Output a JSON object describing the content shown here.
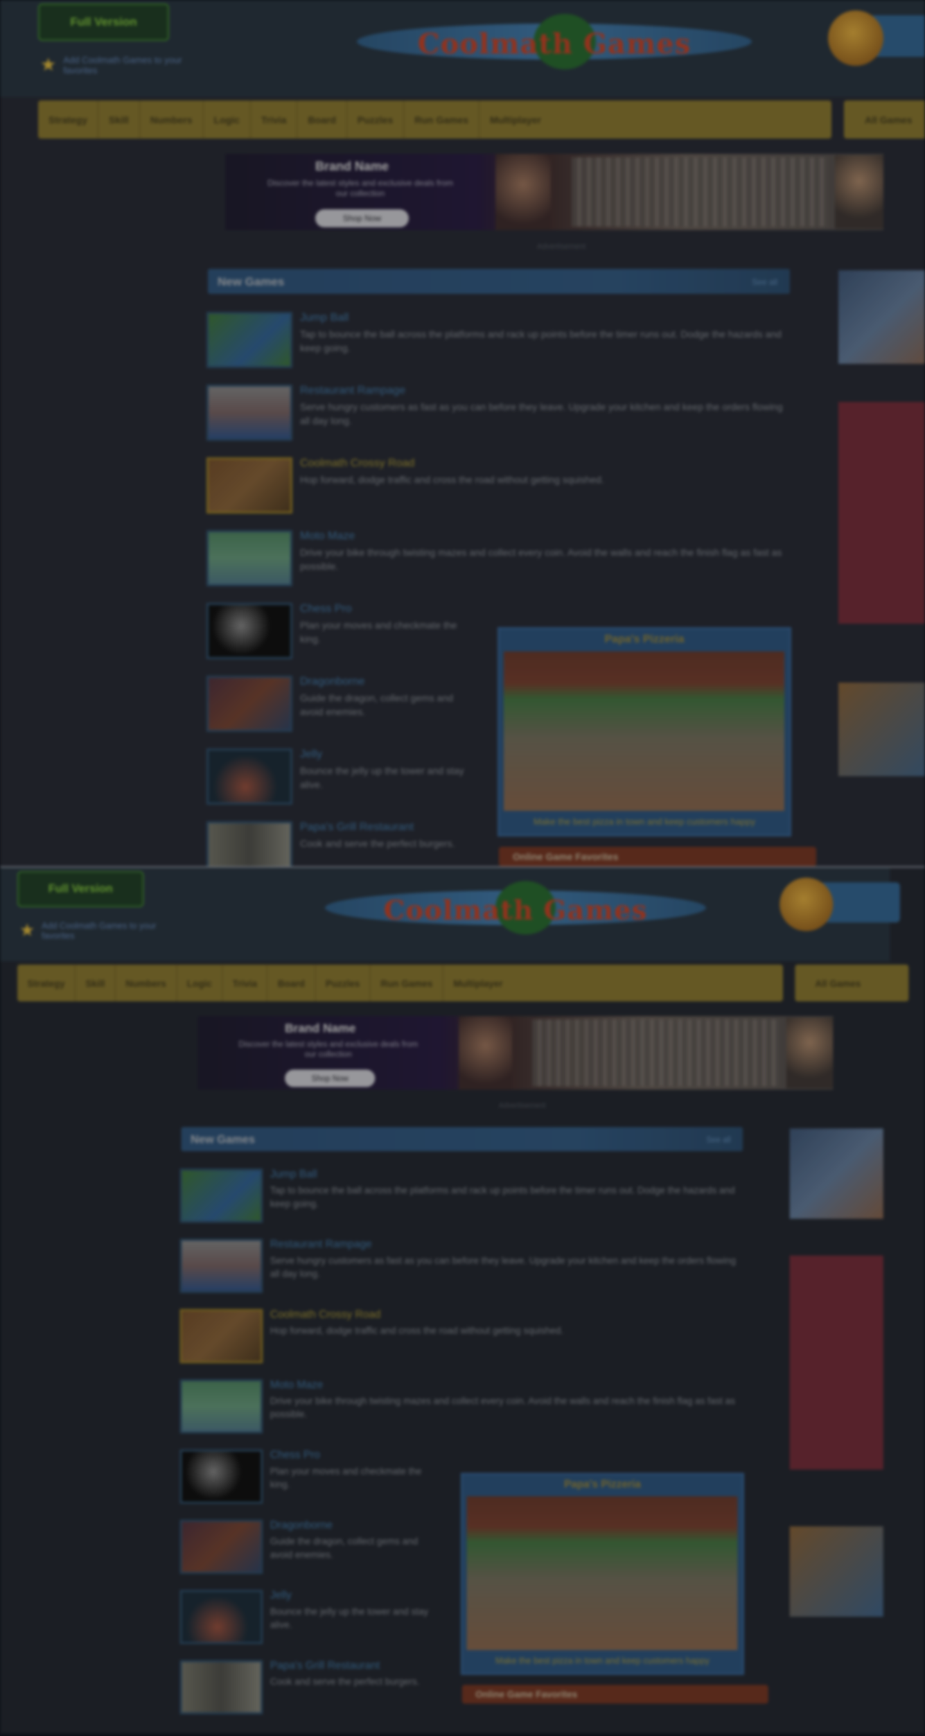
{
  "site": {
    "full_version_button": "Full Version",
    "favorites_text": "Add Coolmath Games to your favorites",
    "logo_text": "Coolmath Games"
  },
  "nav": {
    "items": [
      "Strategy",
      "Skill",
      "Numbers",
      "Logic",
      "Trivia",
      "Board",
      "Puzzles",
      "Run Games",
      "Multiplayer"
    ],
    "extra": "All Games"
  },
  "ad": {
    "brand": "Brand Name",
    "copy": "Discover the latest styles and exclusive deals from our collection",
    "button": "Shop Now",
    "label": "Advertisement"
  },
  "section": {
    "title": "New Games",
    "more": "See all"
  },
  "games": [
    {
      "title": "Jump Ball",
      "desc": "Tap to bounce the ball across the platforms and rack up points before the timer runs out. Dodge the hazards and keep going.",
      "gold": false,
      "narrow": false
    },
    {
      "title": "Restaurant Rampage",
      "desc": "Serve hungry customers as fast as you can before they leave. Upgrade your kitchen and keep the orders flowing all day long.",
      "gold": false,
      "narrow": false
    },
    {
      "title": "Coolmath Crossy Road",
      "desc": "Hop forward, dodge traffic and cross the road without getting squished.",
      "gold": true,
      "narrow": false
    },
    {
      "title": "Moto Maze",
      "desc": "Drive your bike through twisting mazes and collect every coin. Avoid the walls and reach the finish flag as fast as possible.",
      "gold": false,
      "narrow": false
    },
    {
      "title": "Chess Pro",
      "desc": "Plan your moves and checkmate the king.",
      "gold": false,
      "narrow": true
    },
    {
      "title": "Dragonborne",
      "desc": "Guide the dragon, collect gems and avoid enemies.",
      "gold": false,
      "narrow": true
    },
    {
      "title": "Jelly",
      "desc": "Bounce the jelly up the tower and stay alive.",
      "gold": false,
      "narrow": true
    },
    {
      "title": "Papa's Grill Restaurant",
      "desc": "Cook and serve the perfect burgers.",
      "gold": false,
      "narrow": true
    }
  ],
  "feature": {
    "title": "Papa's Pizzeria",
    "caption": "Make the best pizza in town and keep customers happy",
    "bar": "Online Game Favorites"
  },
  "colors": {
    "accent_gold": "#7c6c2d",
    "section_blue": "#2d4d6f",
    "link_blue": "#3e6f99"
  }
}
